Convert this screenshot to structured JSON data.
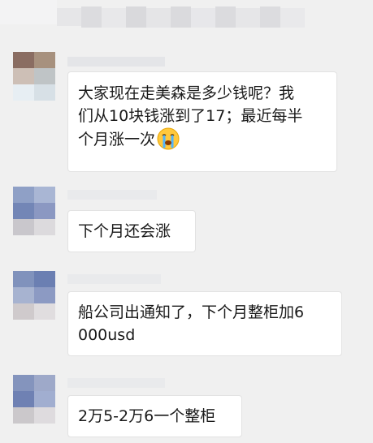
{
  "messages": [
    {
      "lines": [
        "大家现在走美森是多少钱呢？我",
        "们从10块钱涨到了17；最近每半",
        "个月涨一次"
      ],
      "trailing_emoji": "crying-face-emoji"
    },
    {
      "lines": [
        "下个月还会涨"
      ]
    },
    {
      "lines": [
        "船公司出通知了，下个月整柜加6",
        "000usd"
      ]
    },
    {
      "lines": [
        "2万5-2万6一个整柜"
      ]
    }
  ],
  "colors": {
    "background": "#f0f0f0",
    "bubble": "#ffffff",
    "text": "#191919"
  }
}
